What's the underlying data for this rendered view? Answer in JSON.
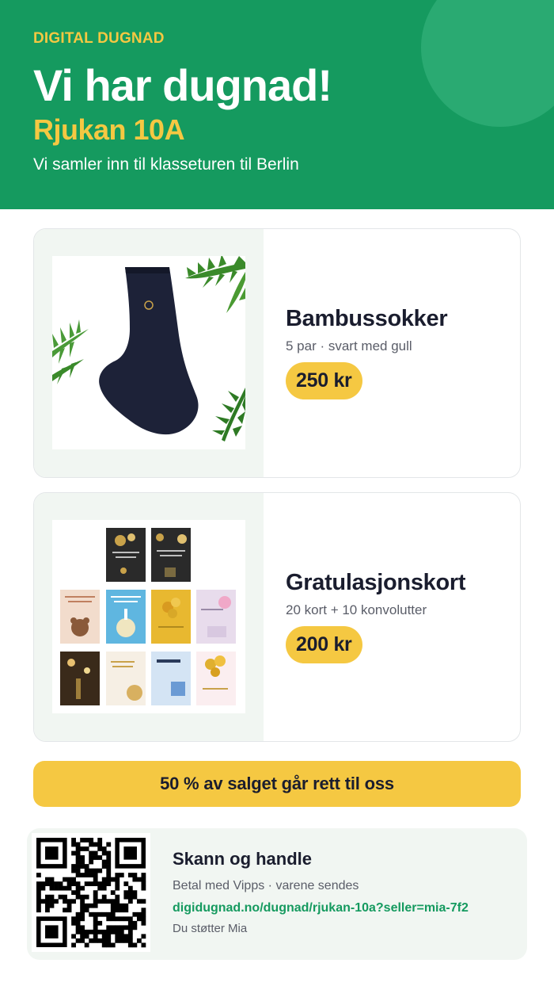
{
  "header": {
    "brand": "DIGITAL DUGNAD",
    "headline": "Vi har dugnad!",
    "class_name": "Rjukan 10A",
    "subtitle": "Vi samler inn til klasseturen til Berlin"
  },
  "products": [
    {
      "name": "Bambussokker",
      "description": "5 par · svart med gull",
      "price": "250 kr",
      "image_icon": "sock-image"
    },
    {
      "name": "Gratulasjonskort",
      "description": "20 kort + 10 konvolutter",
      "price": "200 kr",
      "image_icon": "greeting-cards-image"
    }
  ],
  "banner": {
    "text": "50 % av salget går rett til oss"
  },
  "qr": {
    "title": "Skann og handle",
    "subtitle": "Betal med Vipps · varene sendes",
    "link": "digidugnad.no/dugnad/rjukan-10a?seller=mia-7f2",
    "support": "Du støtter Mia"
  },
  "colors": {
    "header_green": "#159a5f",
    "accent_yellow": "#f5c842",
    "text_dark": "#1a1d2e",
    "link_green": "#159a5f"
  }
}
